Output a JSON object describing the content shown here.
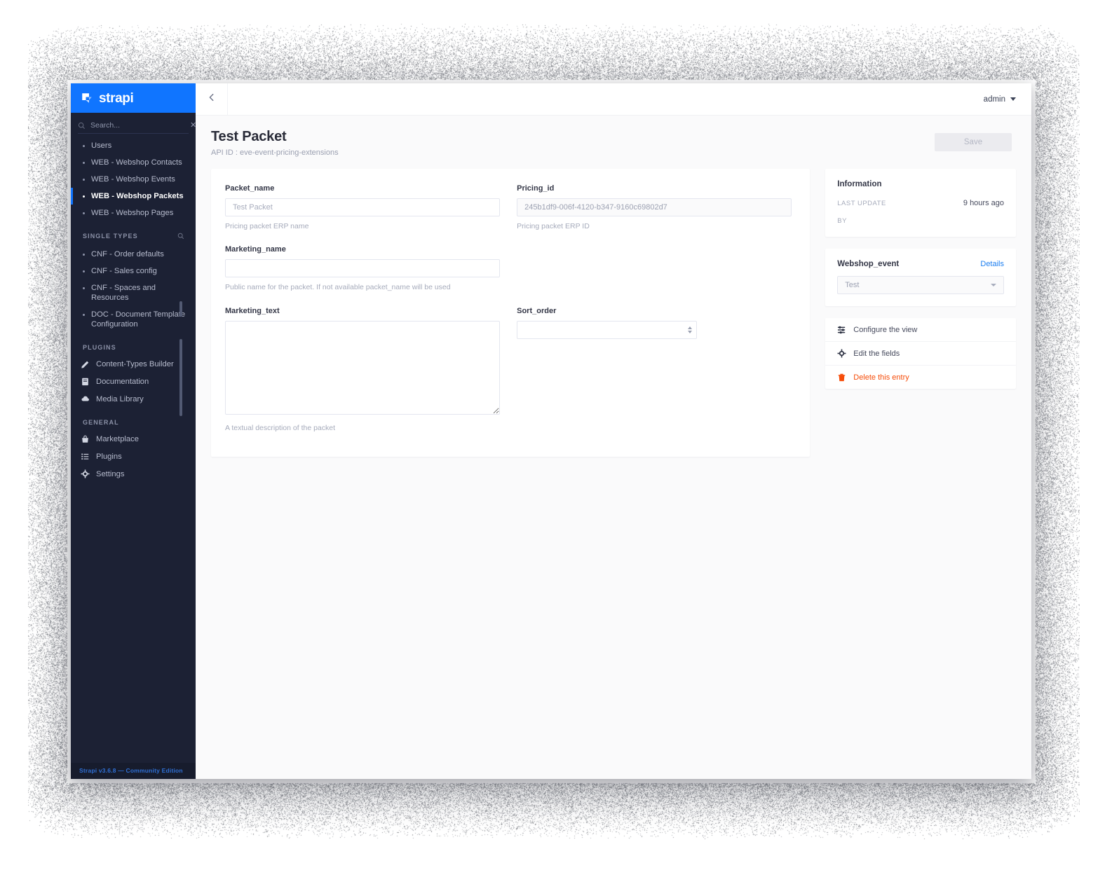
{
  "brand": {
    "name": "strapi",
    "logo_icon": "strapi-cube-icon",
    "brand_color": "#1075ff"
  },
  "sidebar": {
    "search": {
      "placeholder": "Search...",
      "value": "",
      "icon": "search-icon",
      "clear_icon": "close-icon"
    },
    "collection_types": [
      {
        "label": "Users",
        "active": false
      },
      {
        "label": "WEB - Webshop Contacts",
        "active": false
      },
      {
        "label": "WEB - Webshop Events",
        "active": false
      },
      {
        "label": "WEB - Webshop Packets",
        "active": true
      },
      {
        "label": "WEB - Webshop Pages",
        "active": false
      }
    ],
    "single_types_heading": "SINGLE TYPES",
    "single_types_search_icon": "search-icon",
    "single_types": [
      {
        "label": "CNF - Order defaults"
      },
      {
        "label": "CNF - Sales config"
      },
      {
        "label": "CNF - Spaces and Resources"
      },
      {
        "label": "DOC - Document Template Configuration"
      }
    ],
    "plugins_heading": "PLUGINS",
    "plugins": [
      {
        "label": "Content-Types Builder",
        "icon": "pencil-icon"
      },
      {
        "label": "Documentation",
        "icon": "book-icon"
      },
      {
        "label": "Media Library",
        "icon": "cloud-icon"
      }
    ],
    "general_heading": "GENERAL",
    "general": [
      {
        "label": "Marketplace",
        "icon": "shop-icon"
      },
      {
        "label": "Plugins",
        "icon": "list-icon"
      },
      {
        "label": "Settings",
        "icon": "gear-icon"
      }
    ],
    "footer": "Strapi v3.6.8 — Community Edition"
  },
  "topbar": {
    "back_icon": "chevron-left-icon",
    "user": "admin",
    "user_caret_icon": "chevron-down-icon"
  },
  "page": {
    "title": "Test Packet",
    "api_id": "API ID : eve-event-pricing-extensions",
    "save_label": "Save"
  },
  "form": {
    "packet_name": {
      "label": "Packet_name",
      "value": "",
      "placeholder": "Test Packet",
      "hint": "Pricing packet ERP name"
    },
    "pricing_id": {
      "label": "Pricing_id",
      "value": "245b1df9-006f-4120-b347-9160c69802d7",
      "placeholder": "",
      "hint": "Pricing packet ERP ID"
    },
    "marketing_name": {
      "label": "Marketing_name",
      "value": "",
      "placeholder": "",
      "hint": "Public name for the packet. If not available packet_name will be used"
    },
    "marketing_text": {
      "label": "Marketing_text",
      "value": "",
      "placeholder": "",
      "hint": "A textual description of the packet"
    },
    "sort_order": {
      "label": "Sort_order",
      "value": "",
      "placeholder": ""
    }
  },
  "information_panel": {
    "title": "Information",
    "last_update_label": "LAST UPDATE",
    "last_update_value": "9 hours ago",
    "by_label": "BY",
    "by_value": ""
  },
  "relation_panel": {
    "title": "Webshop_event",
    "details_label": "Details",
    "selected": "Test",
    "caret_icon": "chevron-down-icon"
  },
  "actions": [
    {
      "label": "Configure the view",
      "icon": "sliders-icon",
      "danger": false
    },
    {
      "label": "Edit the fields",
      "icon": "gear-icon",
      "danger": false
    },
    {
      "label": "Delete this entry",
      "icon": "trash-icon",
      "danger": true
    }
  ],
  "colors": {
    "sidebar_bg": "#1c2134",
    "accent_blue": "#1075ff",
    "link_blue": "#1c7ef0",
    "danger": "#f64d0a",
    "canvas": "#fafafb"
  }
}
